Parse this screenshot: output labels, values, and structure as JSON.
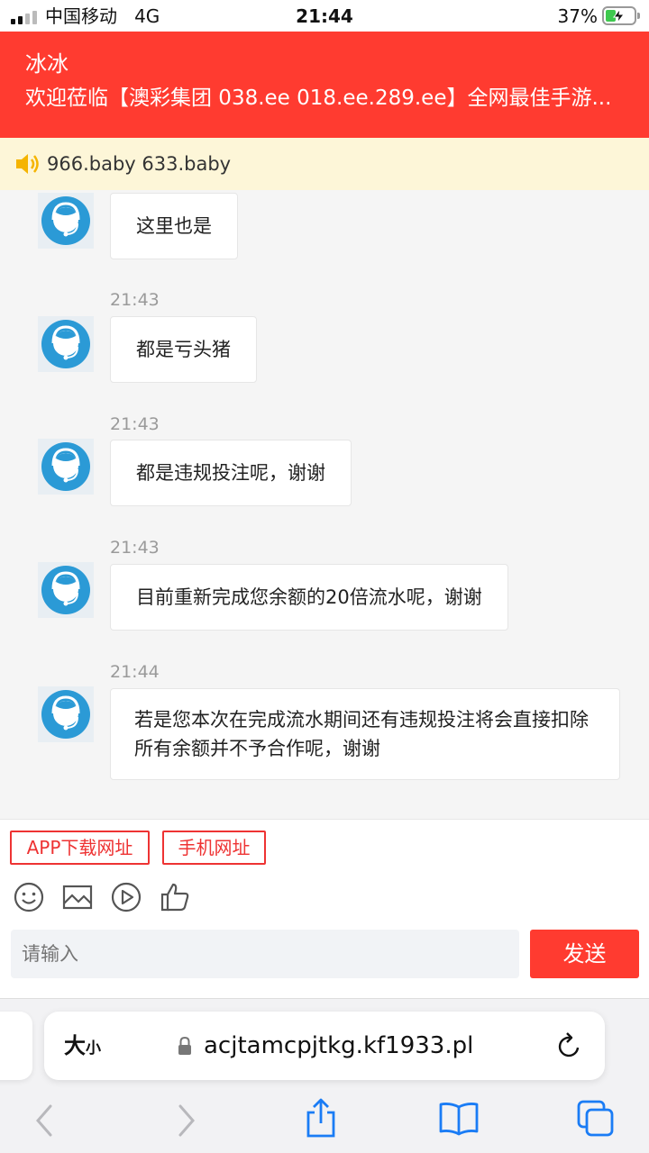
{
  "status_bar": {
    "carrier": "中国移动",
    "network": "4G",
    "time": "21:44",
    "battery_percent": "37%",
    "battery_level": 0.37
  },
  "header": {
    "agent_name": "冰冰",
    "welcome": "欢迎莅临【澳彩集团 038.ee 018.ee.289.ee】全网最佳手游..."
  },
  "notice": {
    "icon": "speaker-icon",
    "text": "966.baby 633.baby"
  },
  "messages": [
    {
      "time": "",
      "text": "这里也是"
    },
    {
      "time": "21:43",
      "text": "都是亏头猪"
    },
    {
      "time": "21:43",
      "text": "都是违规投注呢，谢谢"
    },
    {
      "time": "21:43",
      "text": "目前重新完成您余额的20倍流水呢，谢谢"
    },
    {
      "time": "21:44",
      "text": "若是您本次在完成流水期间还有违规投注将会直接扣除所有余额并不予合作呢，谢谢"
    }
  ],
  "quick_links": {
    "app_download": "APP下载网址",
    "mobile_site": "手机网址"
  },
  "toolbar": {
    "icons": [
      "emoji-icon",
      "image-icon",
      "video-icon",
      "thumbs-up-icon"
    ]
  },
  "composer": {
    "placeholder": "请输入",
    "send_label": "发送"
  },
  "browser": {
    "text_size_big": "大",
    "text_size_small": "小",
    "url": "acjtamcpjtkg.kf1933.pl"
  },
  "colors": {
    "accent": "#ff3b30",
    "notice_bg": "#fdf6d8",
    "avatar_blue": "#2b9ad6"
  }
}
